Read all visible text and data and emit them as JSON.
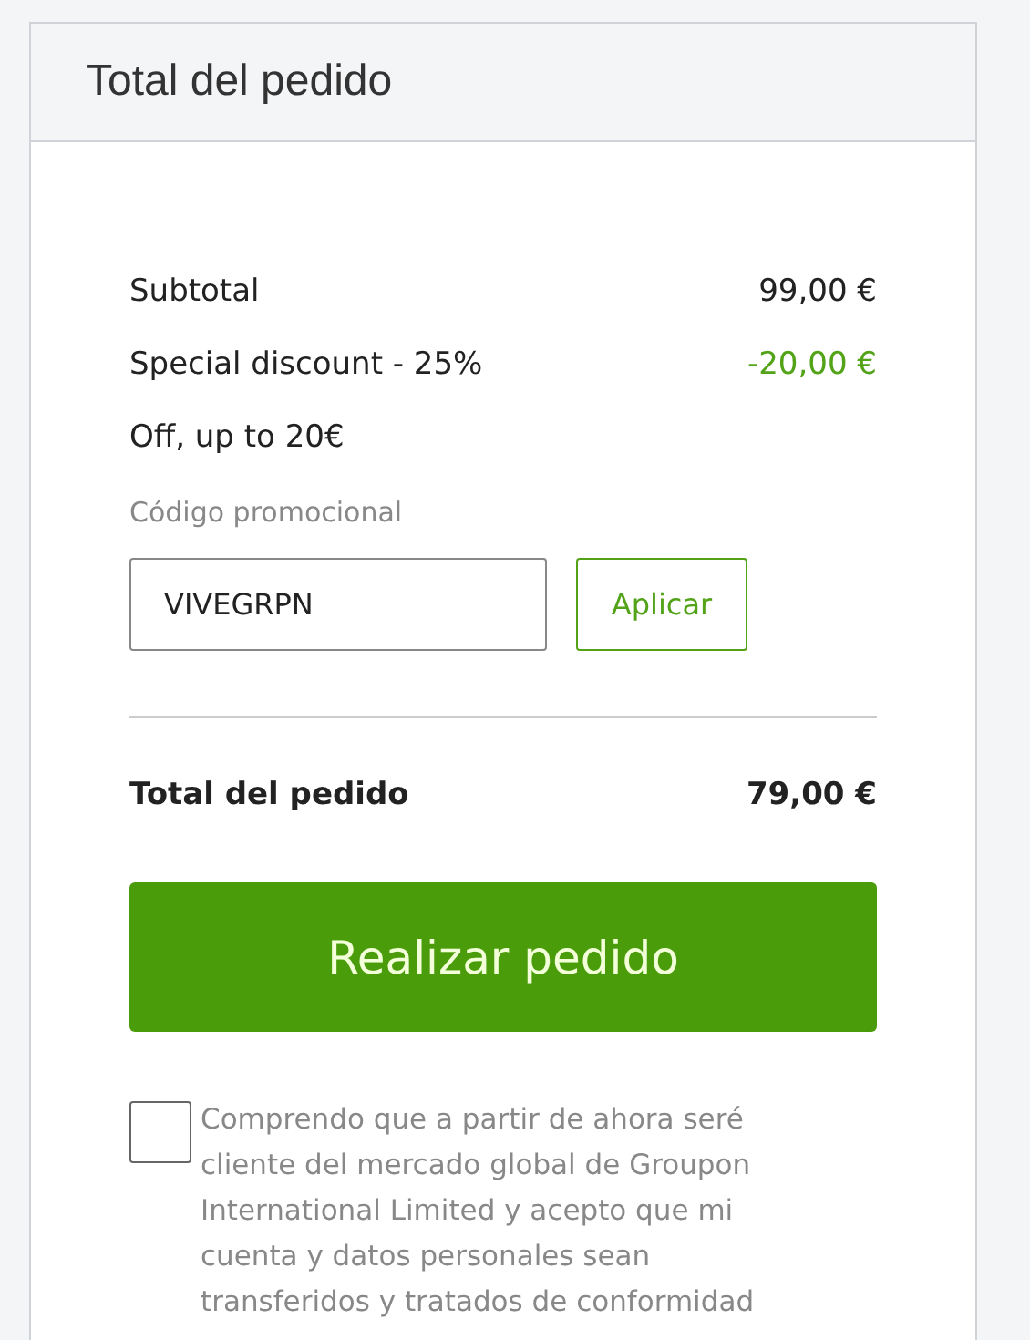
{
  "panel": {
    "title": "Total del pedido"
  },
  "summary": [
    {
      "label": "Subtotal",
      "value": "99,00 €",
      "kind": "normal"
    },
    {
      "label": "Special discount - 25%",
      "value": "-20,00 €",
      "kind": "discount"
    },
    {
      "label": "Off, up to 20€",
      "kind": "normal"
    }
  ],
  "promo": {
    "label": "Código promocional",
    "value": "VIVEGRPN",
    "button": "Aplicar"
  },
  "total": {
    "label": "Total del pedido",
    "value": "79,00 €"
  },
  "order_button": "Realizar pedido",
  "consent": {
    "checked": false,
    "text": "Comprendo que a partir de ahora seré cliente del mercado global de Groupon International Limited y acepto que mi cuenta y datos personales sean transferidos y tratados de conformidad"
  }
}
